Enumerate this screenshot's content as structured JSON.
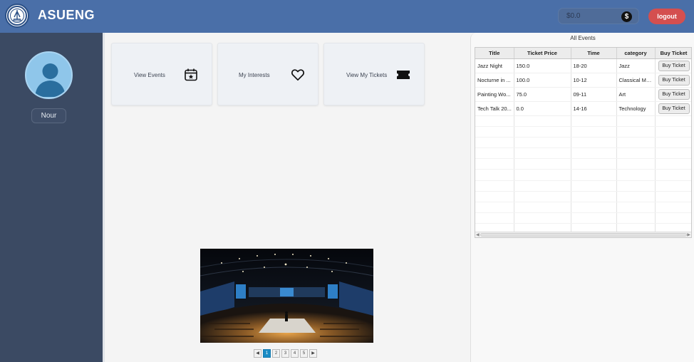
{
  "header": {
    "app_title": "ASUENG",
    "balance": "$0.0",
    "logout_label": "logout"
  },
  "sidebar": {
    "username": "Nour"
  },
  "cards": [
    {
      "label": "View Events",
      "icon": "calendar-star-icon"
    },
    {
      "label": "My Interests",
      "icon": "heart-icon"
    },
    {
      "label": "View My Tickets",
      "icon": "ticket-icon"
    }
  ],
  "slideshow": {
    "pages": [
      "1",
      "2",
      "3",
      "4",
      "5"
    ],
    "current_page": "1",
    "prev_label": "◀",
    "next_label": "▶"
  },
  "events_panel": {
    "title": "All Events",
    "columns": [
      "Title",
      "Ticket Price",
      "Time",
      "category",
      "Buy Ticket"
    ],
    "rows": [
      {
        "title": "Jazz Night",
        "price": "150.0",
        "time": "18-20",
        "category": "Jazz",
        "action": "Buy Ticket"
      },
      {
        "title": "Nocturne in ...",
        "price": "100.0",
        "time": "10-12",
        "category": "Classical Music",
        "action": "Buy Ticket"
      },
      {
        "title": "Painting Wo...",
        "price": "75.0",
        "time": "09-11",
        "category": "Art",
        "action": "Buy Ticket"
      },
      {
        "title": "Tech Talk 20...",
        "price": "0.0",
        "time": "14-16",
        "category": "Technology",
        "action": "Buy Ticket"
      }
    ]
  },
  "colors": {
    "header": "#4a6fa8",
    "sidebar": "#3b4a63",
    "logout": "#d44f4f",
    "active_page": "#1a8bc4"
  }
}
